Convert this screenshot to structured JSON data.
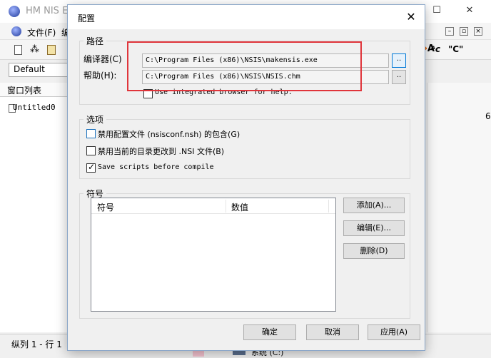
{
  "main_window": {
    "title": "HM NIS E",
    "controls": {
      "minimize": "—",
      "maximize": "☐",
      "close": "✕"
    },
    "menu": {
      "file": "文件(F)",
      "edit": "编"
    },
    "toolbar": {
      "find_glyph": "A",
      "quote_glyph": "\"C\""
    },
    "combo_value": "Default",
    "window_list": {
      "title": "窗口列表",
      "items": [
        "Untitled0"
      ]
    },
    "right_pane_fragment": "6",
    "status_bar": {
      "text": "纵列 1 - 行 1",
      "right_fragment": "系统 (C:)"
    }
  },
  "dialog": {
    "title": "配置",
    "close_glyph": "✕",
    "paths": {
      "caption": "路径",
      "compiler_label": "编译器(C)",
      "compiler_value": "C:\\Program Files (x86)\\NSIS\\makensis.exe",
      "help_label": "帮助(H):",
      "help_value": "C:\\Program Files (x86)\\NSIS\\NSIS.chm",
      "browse_label": "..",
      "use_browser_label": "Use integrated browser for help."
    },
    "options": {
      "caption": "选项",
      "items": [
        {
          "label": "禁用配置文件 (nsisconf.nsh) 的包含(G)",
          "checked": false
        },
        {
          "label": "禁用当前的目录更改到 .NSI 文件(B)",
          "checked": false
        },
        {
          "label": "Save scripts before compile",
          "checked": true
        }
      ]
    },
    "symbols": {
      "caption": "符号",
      "columns": [
        "符号",
        "数值"
      ],
      "add_label": "添加(A)...",
      "edit_label": "编辑(E)...",
      "delete_label": "删除(D)"
    },
    "buttons": {
      "ok": "确定",
      "cancel": "取消",
      "apply": "应用(A)"
    }
  },
  "colors": {
    "highlight_box": "#e0353b",
    "focus_blue": "#0078d7"
  }
}
